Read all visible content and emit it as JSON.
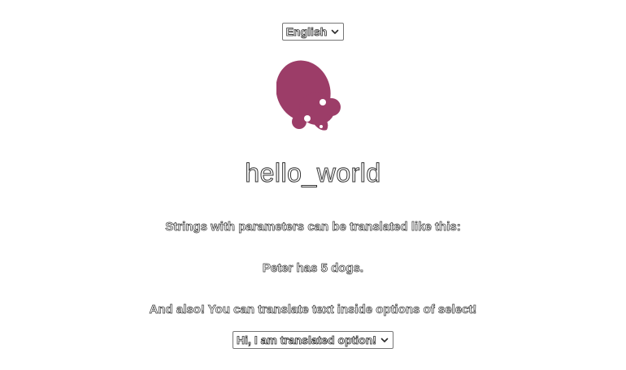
{
  "language_select": {
    "selected": "English",
    "icon": "chevron-down-icon"
  },
  "logo": {
    "icon": "mouse-logo-icon",
    "color": "#9c3d68"
  },
  "main": {
    "title": "hello_world",
    "params_intro": "Strings with parameters can be translated like this:",
    "params_example": "Peter has 5 dogs.",
    "options_intro": "And also! You can translate text inside options of select!"
  },
  "option_select": {
    "selected": "Hi, I am translated option!",
    "icon": "chevron-down-icon"
  }
}
